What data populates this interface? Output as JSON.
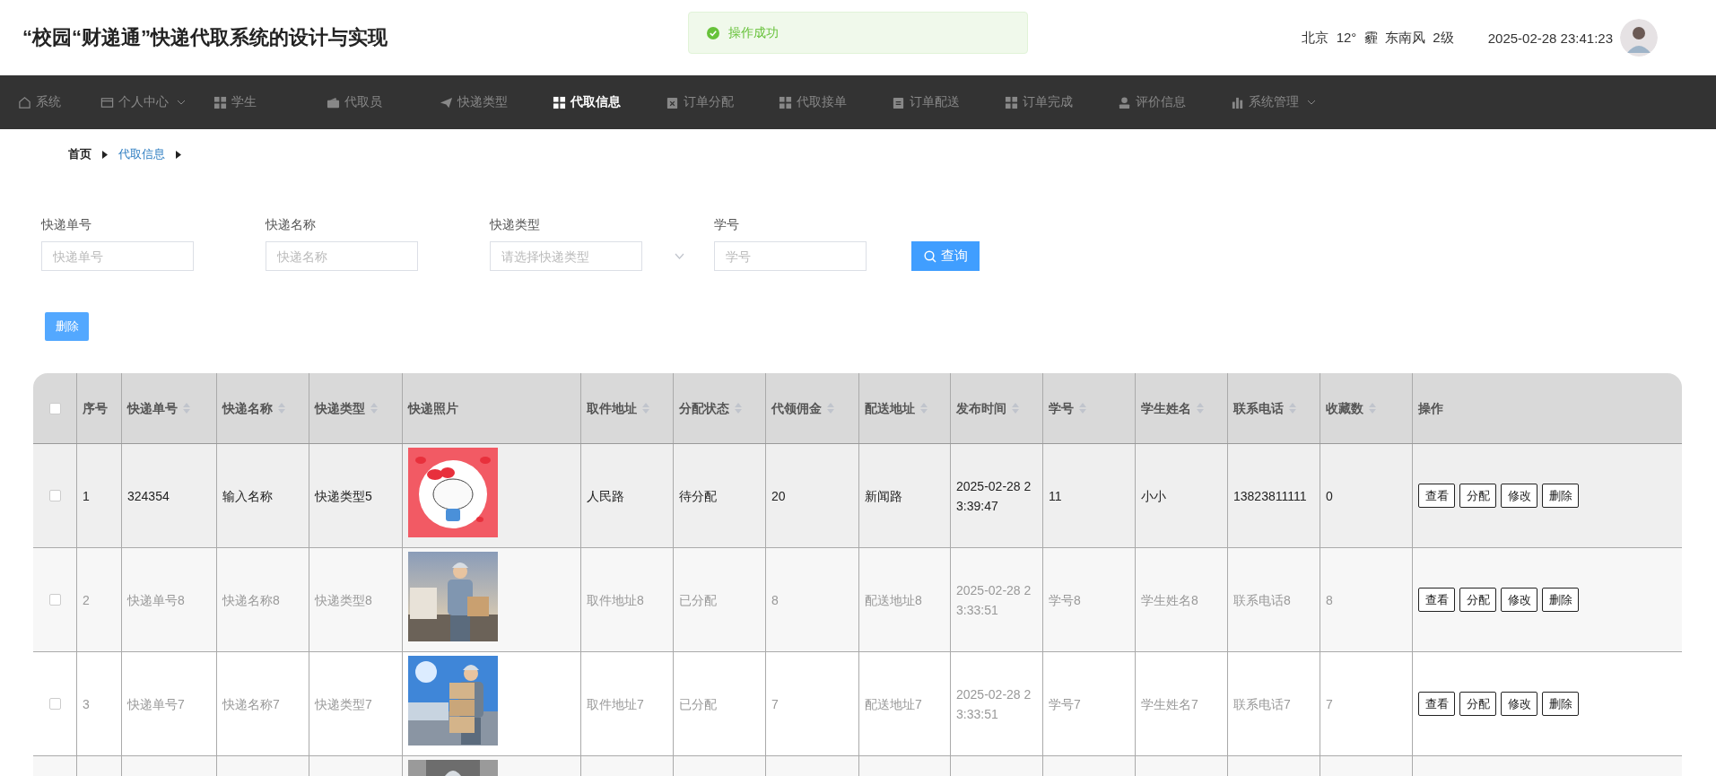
{
  "header": {
    "title": "“校园“财递通”快递代取系统的设计与实现",
    "weather": "北京  12°  霾  东南风  2级",
    "datetime": "2025-02-28 23:41:23"
  },
  "toast": {
    "message": "操作成功"
  },
  "nav": [
    {
      "label": "系统",
      "selected": false,
      "dropdown": false
    },
    {
      "label": "个人中心",
      "selected": false,
      "dropdown": true
    },
    {
      "label": "学生",
      "selected": false,
      "dropdown": false
    },
    {
      "label": "代取员",
      "selected": false,
      "dropdown": false
    },
    {
      "label": "快递类型",
      "selected": false,
      "dropdown": false
    },
    {
      "label": "代取信息",
      "selected": true,
      "dropdown": false
    },
    {
      "label": "订单分配",
      "selected": false,
      "dropdown": false
    },
    {
      "label": "代取接单",
      "selected": false,
      "dropdown": false
    },
    {
      "label": "订单配送",
      "selected": false,
      "dropdown": false
    },
    {
      "label": "订单完成",
      "selected": false,
      "dropdown": false
    },
    {
      "label": "评价信息",
      "selected": false,
      "dropdown": false
    },
    {
      "label": "系统管理",
      "selected": false,
      "dropdown": true
    }
  ],
  "breadcrumb": [
    {
      "label": "首页",
      "current": false
    },
    {
      "label": "代取信息",
      "current": true
    }
  ],
  "filters": [
    {
      "label": "快递单号",
      "placeholder": "快递单号",
      "kind": "input"
    },
    {
      "label": "快递名称",
      "placeholder": "快递名称",
      "kind": "input"
    },
    {
      "label": "快递类型",
      "placeholder": "请选择快递类型",
      "kind": "select"
    },
    {
      "label": "学号",
      "placeholder": "学号",
      "kind": "input"
    }
  ],
  "search_button": "查询",
  "delete_button": "删除",
  "table": {
    "header_checked": false,
    "columns": [
      {
        "label": "序号",
        "sortable": false,
        "kind": "text"
      },
      {
        "label": "快递单号",
        "sortable": true,
        "kind": "text"
      },
      {
        "label": "快递名称",
        "sortable": true,
        "kind": "text"
      },
      {
        "label": "快递类型",
        "sortable": true,
        "kind": "text"
      },
      {
        "label": "快递照片",
        "sortable": false
      },
      {
        "label": "取件地址",
        "sortable": true,
        "kind": "text"
      },
      {
        "label": "分配状态",
        "sortable": true,
        "kind": "text"
      },
      {
        "label": "代领佣金",
        "sortable": true,
        "kind": "text"
      },
      {
        "label": "配送地址",
        "sortable": true,
        "kind": "text"
      },
      {
        "label": "发布时间",
        "sortable": true,
        "kind": "text"
      },
      {
        "label": "学号",
        "sortable": true,
        "kind": "text"
      },
      {
        "label": "学生姓名",
        "sortable": true,
        "kind": "text"
      },
      {
        "label": "联系电话",
        "sortable": true,
        "kind": "text"
      },
      {
        "label": "收藏数",
        "sortable": true,
        "kind": "text"
      },
      {
        "label": "操作",
        "sortable": false,
        "kind": "actions"
      }
    ],
    "rows": [
      {
        "highlighted": true,
        "checked": false,
        "values": [
          "1",
          "324354",
          "输入名称",
          "快递类型5",
          "人民路",
          "待分配",
          "20",
          "新闻路",
          "2025-02-28 23:39:47",
          "11",
          "小小",
          "13823811111",
          "0"
        ],
        "actions": [
          "查看",
          "分配",
          "修改",
          "删除"
        ]
      },
      {
        "highlighted": false,
        "checked": false,
        "values": [
          "2",
          "快递单号8",
          "快递名称8",
          "快递类型8",
          "取件地址8",
          "已分配",
          "8",
          "配送地址8",
          "2025-02-28 23:33:51",
          "学号8",
          "学生姓名8",
          "联系电话8",
          "8"
        ],
        "actions": [
          "查看",
          "分配",
          "修改",
          "删除"
        ]
      },
      {
        "highlighted": false,
        "checked": false,
        "values": [
          "3",
          "快递单号7",
          "快递名称7",
          "快递类型7",
          "取件地址7",
          "已分配",
          "7",
          "配送地址7",
          "2025-02-28 23:33:51",
          "学号7",
          "学生姓名7",
          "联系电话7",
          "7"
        ],
        "actions": [
          "查看",
          "分配",
          "修改",
          "删除"
        ]
      }
    ]
  }
}
